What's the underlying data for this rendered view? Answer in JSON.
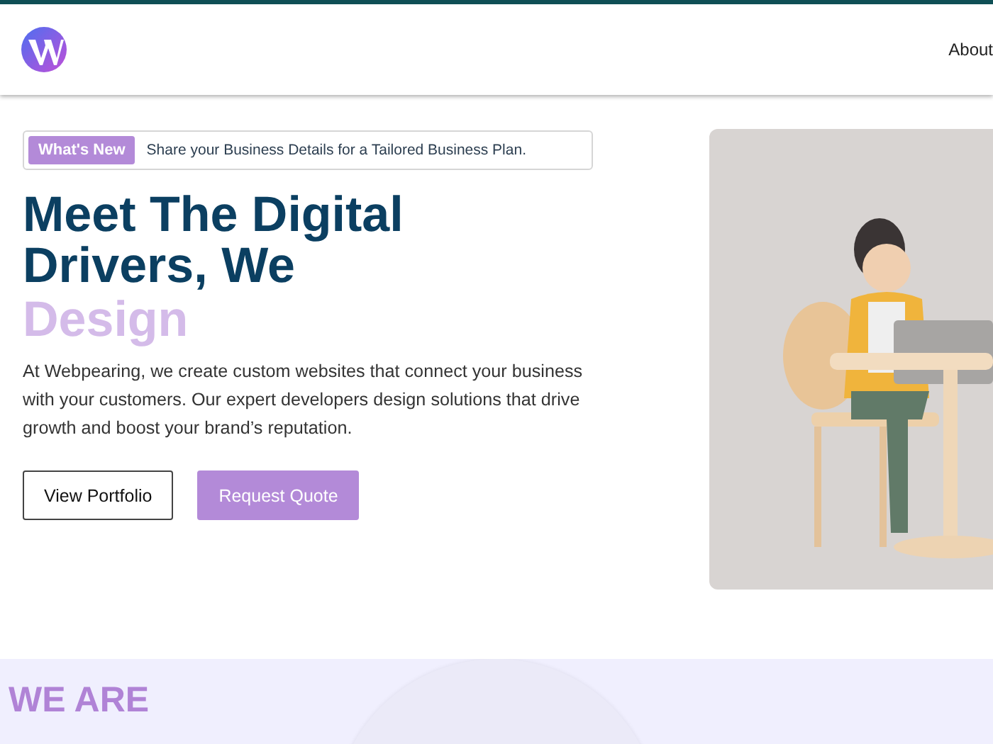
{
  "header": {
    "nav": [
      {
        "label": "About"
      }
    ]
  },
  "hero": {
    "badge": {
      "tag": "What's New",
      "text": "Share your Business Details for a Tailored Business Plan."
    },
    "heading_lines": [
      "Meet The Digital",
      "Drivers, We"
    ],
    "heading_accent": "Design",
    "description": "At Webpearing, we create custom websites that connect your business with your customers. Our expert developers design solutions that drive growth and boost your brand’s reputation.",
    "buttons": [
      {
        "label": "View Portfolio",
        "kind": "outline"
      },
      {
        "label": "Request Quote",
        "kind": "filled"
      }
    ]
  },
  "about": {
    "eyebrow": "WE ARE"
  }
}
